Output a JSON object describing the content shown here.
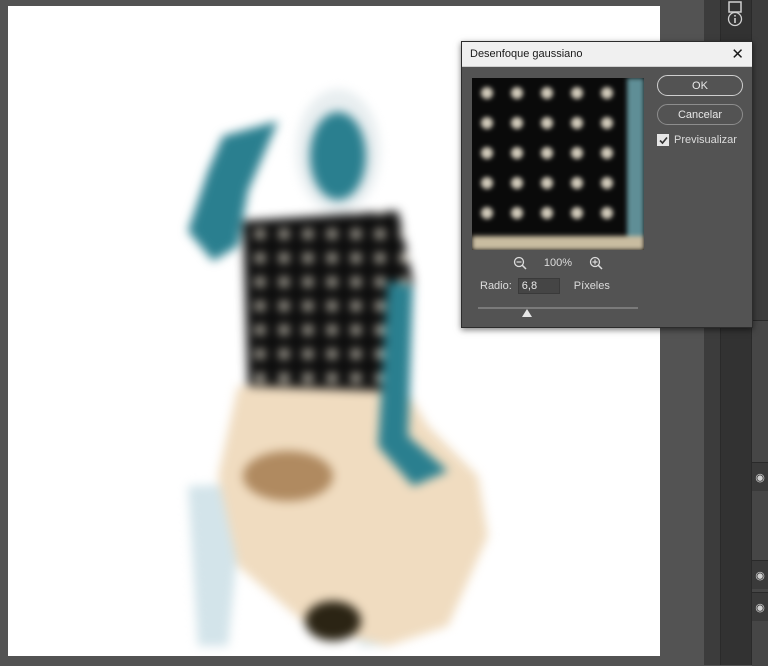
{
  "dialog": {
    "title": "Desenfoque gaussiano",
    "zoom_level": "100%",
    "radius_label": "Radio:",
    "radius_value": "6,8",
    "radius_unit": "Píxeles",
    "ok_label": "OK",
    "cancel_label": "Cancelar",
    "preview_label": "Previsualizar",
    "preview_checked": true
  },
  "icons": {
    "close": "close-icon",
    "zoom_out": "zoom-out-icon",
    "zoom_in": "zoom-in-icon",
    "info": "info-icon",
    "eye": "eye-icon"
  },
  "colors": {
    "workspace": "#535353",
    "canvas": "#ffffff",
    "dialog_body": "#535353",
    "dialog_titlebar": "#f0f0f0",
    "figure_skin": "#2a7f8f",
    "figure_pants": "#f0dcc0",
    "shirt": "#0d0d0d"
  }
}
